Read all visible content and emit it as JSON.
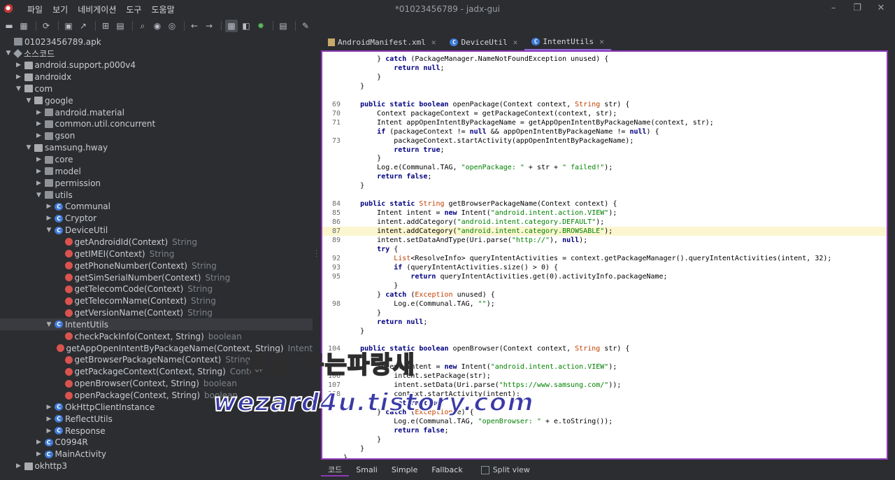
{
  "window": {
    "title": "*01023456789 - jadx-gui"
  },
  "menu": [
    "파일",
    "보기",
    "네비게이션",
    "도구",
    "도움말"
  ],
  "tree": [
    {
      "label": "01023456789.apk",
      "indent": 0,
      "icon": "apk",
      "arrow": ""
    },
    {
      "label": "소스코드",
      "indent": 0,
      "icon": "src",
      "arrow": "▼"
    },
    {
      "label": "android.support.p000v4",
      "indent": 1,
      "icon": "folder",
      "arrow": "▶"
    },
    {
      "label": "androidx",
      "indent": 1,
      "icon": "folder",
      "arrow": "▶"
    },
    {
      "label": "com",
      "indent": 1,
      "icon": "folder",
      "arrow": "▼"
    },
    {
      "label": "google",
      "indent": 2,
      "icon": "folder",
      "arrow": "▼"
    },
    {
      "label": "android.material",
      "indent": 3,
      "icon": "pkg",
      "arrow": "▶"
    },
    {
      "label": "common.util.concurrent",
      "indent": 3,
      "icon": "pkg",
      "arrow": "▶"
    },
    {
      "label": "gson",
      "indent": 3,
      "icon": "pkg",
      "arrow": "▶"
    },
    {
      "label": "samsung.hway",
      "indent": 2,
      "icon": "folder",
      "arrow": "▼"
    },
    {
      "label": "core",
      "indent": 3,
      "icon": "pkg",
      "arrow": "▶"
    },
    {
      "label": "model",
      "indent": 3,
      "icon": "pkg",
      "arrow": "▶"
    },
    {
      "label": "permission",
      "indent": 3,
      "icon": "pkg",
      "arrow": "▶"
    },
    {
      "label": "utils",
      "indent": 3,
      "icon": "pkg",
      "arrow": "▼"
    },
    {
      "label": "Communal",
      "indent": 4,
      "icon": "cls",
      "arrow": "▶"
    },
    {
      "label": "Cryptor",
      "indent": 4,
      "icon": "cls",
      "arrow": "▶"
    },
    {
      "label": "DeviceUtil",
      "indent": 4,
      "icon": "cls",
      "arrow": "▼"
    },
    {
      "label": "getAndroidId(Context)",
      "ret": "String",
      "indent": 5,
      "icon": "mth",
      "arrow": ""
    },
    {
      "label": "getIMEI(Context)",
      "ret": "String",
      "indent": 5,
      "icon": "mth",
      "arrow": ""
    },
    {
      "label": "getPhoneNumber(Context)",
      "ret": "String",
      "indent": 5,
      "icon": "mth",
      "arrow": ""
    },
    {
      "label": "getSimSerialNumber(Context)",
      "ret": "String",
      "indent": 5,
      "icon": "mth",
      "arrow": ""
    },
    {
      "label": "getTelecomCode(Context)",
      "ret": "String",
      "indent": 5,
      "icon": "mth",
      "arrow": ""
    },
    {
      "label": "getTelecomName(Context)",
      "ret": "String",
      "indent": 5,
      "icon": "mth",
      "arrow": ""
    },
    {
      "label": "getVersionName(Context)",
      "ret": "String",
      "indent": 5,
      "icon": "mth",
      "arrow": ""
    },
    {
      "label": "IntentUtils",
      "indent": 4,
      "icon": "cls",
      "arrow": "▼",
      "selected": true
    },
    {
      "label": "checkPackInfo(Context, String)",
      "ret": "boolean",
      "indent": 5,
      "icon": "mth",
      "arrow": ""
    },
    {
      "label": "getAppOpenIntentByPackageName(Context, String)",
      "ret": "Intent",
      "indent": 5,
      "icon": "mth",
      "arrow": ""
    },
    {
      "label": "getBrowserPackageName(Context)",
      "ret": "String",
      "indent": 5,
      "icon": "mth",
      "arrow": ""
    },
    {
      "label": "getPackageContext(Context, String)",
      "ret": "Context",
      "indent": 5,
      "icon": "mth",
      "arrow": ""
    },
    {
      "label": "openBrowser(Context, String)",
      "ret": "boolean",
      "indent": 5,
      "icon": "mth",
      "arrow": ""
    },
    {
      "label": "openPackage(Context, String)",
      "ret": "boolean",
      "indent": 5,
      "icon": "mth",
      "arrow": ""
    },
    {
      "label": "OkHttpClientInstance",
      "indent": 4,
      "icon": "cls",
      "arrow": "▶"
    },
    {
      "label": "ReflectUtils",
      "indent": 4,
      "icon": "cls",
      "arrow": "▶"
    },
    {
      "label": "Response",
      "indent": 4,
      "icon": "cls",
      "arrow": "▶"
    },
    {
      "label": "C0994R",
      "indent": 3,
      "icon": "cls",
      "arrow": "▶"
    },
    {
      "label": "MainActivity",
      "indent": 3,
      "icon": "cls",
      "arrow": "▶"
    },
    {
      "label": "okhttp3",
      "indent": 1,
      "icon": "folder",
      "arrow": "▶"
    }
  ],
  "tabs": [
    {
      "label": "AndroidManifest.xml",
      "icon": "file"
    },
    {
      "label": "DeviceUtil",
      "icon": "cls"
    },
    {
      "label": "IntentUtils",
      "icon": "cls",
      "active": true
    }
  ],
  "code": [
    {
      "n": "",
      "t": "        } <kw>catch</kw> (PackageManager.NameNotFoundException unused) {"
    },
    {
      "n": "",
      "t": "            <kw>return null</kw>;"
    },
    {
      "n": "",
      "t": "        }"
    },
    {
      "n": "",
      "t": "    }"
    },
    {
      "n": "",
      "t": ""
    },
    {
      "n": "69",
      "t": "    <kw>public static boolean</kw> openPackage(Context context, <ty>String</ty> str) {"
    },
    {
      "n": "70",
      "t": "        Context packageContext = getPackageContext(context, str);"
    },
    {
      "n": "71",
      "t": "        Intent appOpenIntentByPackageName = getAppOpenIntentByPackageName(context, str);"
    },
    {
      "n": "",
      "t": "        <kw>if</kw> (packageContext != <kw>null</kw> && appOpenIntentByPackageName != <kw>null</kw>) {"
    },
    {
      "n": "73",
      "t": "            packageContext.startActivity(appOpenIntentByPackageName);"
    },
    {
      "n": "",
      "t": "            <kw>return true</kw>;"
    },
    {
      "n": "",
      "t": "        }"
    },
    {
      "n": "",
      "t": "        Log.e(Communal.TAG, <st>\"openPackage: \"</st> + str + <st>\" failed!\"</st>);"
    },
    {
      "n": "",
      "t": "        <kw>return false</kw>;"
    },
    {
      "n": "",
      "t": "    }"
    },
    {
      "n": "",
      "t": ""
    },
    {
      "n": "84",
      "t": "    <kw>public static</kw> <ty>String</ty> getBrowserPackageName(Context context) {"
    },
    {
      "n": "85",
      "t": "        Intent intent = <kw>new</kw> Intent(<st>\"android.intent.action.VIEW\"</st>);"
    },
    {
      "n": "86",
      "t": "        intent.addCategory(<st>\"android.intent.category.DEFAULT\"</st>);"
    },
    {
      "n": "87",
      "t": "        intent.addCategory(<st>\"android.intent.category.BROWSABLE\"</st>);",
      "hl": true
    },
    {
      "n": "89",
      "t": "        intent.setDataAndType(Uri.parse(<st>\"http://\"</st>), <kw>null</kw>);"
    },
    {
      "n": "",
      "t": "        <kw>try</kw> {"
    },
    {
      "n": "92",
      "t": "            <ty>List</ty><ResolveInfo> queryIntentActivities = context.getPackageManager().queryIntentActivities(intent, 32);"
    },
    {
      "n": "93",
      "t": "            <kw>if</kw> (queryIntentActivities.size() > 0) {"
    },
    {
      "n": "95",
      "t": "                <kw>return</kw> queryIntentActivities.get(0).activityInfo.packageName;"
    },
    {
      "n": "",
      "t": "            }"
    },
    {
      "n": "",
      "t": "        } <kw>catch</kw> (<ty>Exception</ty> unused) {"
    },
    {
      "n": "98",
      "t": "            Log.e(Communal.TAG, <st>\"\"</st>);"
    },
    {
      "n": "",
      "t": "        }"
    },
    {
      "n": "",
      "t": "        <kw>return null</kw>;"
    },
    {
      "n": "",
      "t": "    }"
    },
    {
      "n": "",
      "t": ""
    },
    {
      "n": "104",
      "t": "    <kw>public static boolean</kw> openBrowser(Context context, <ty>String</ty> str) {"
    },
    {
      "n": "",
      "t": ""
    },
    {
      "n": "",
      "t": "        Intent intent = <kw>new</kw> Intent(<st>\"android.intent.action.VIEW\"</st>);"
    },
    {
      "n": "106",
      "t": "            intent.setPackage(str);"
    },
    {
      "n": "107",
      "t": "            intent.setData(Uri.parse(<st>\"https://www.samsung.com/\"</st>));"
    },
    {
      "n": "108",
      "t": "            context.startActivity(intent);"
    },
    {
      "n": "",
      "t": "            <kw>return true</kw>;"
    },
    {
      "n": "",
      "t": "        } <kw>catch</kw> (<ty>Exception</ty> e) {"
    },
    {
      "n": "",
      "t": "            Log.e(Communal.TAG, <st>\"openBrowser: \"</st> + e.toString());"
    },
    {
      "n": "",
      "t": "            <kw>return false</kw>;"
    },
    {
      "n": "",
      "t": "        }"
    },
    {
      "n": "",
      "t": "    }"
    },
    {
      "n": "",
      "t": "}"
    }
  ],
  "bottom_tabs": [
    "코드",
    "Smali",
    "Simple",
    "Fallback"
  ],
  "split_view_label": "Split view",
  "watermark": {
    "line1": "꿈을 꾸는파랑새",
    "line2": "wezard4u.tistory.com"
  },
  "colors": {
    "accent": "#8e3ab8",
    "highlight": "#fbf6cf",
    "keyword": "#000080",
    "string": "#008000",
    "type": "#c04000"
  }
}
